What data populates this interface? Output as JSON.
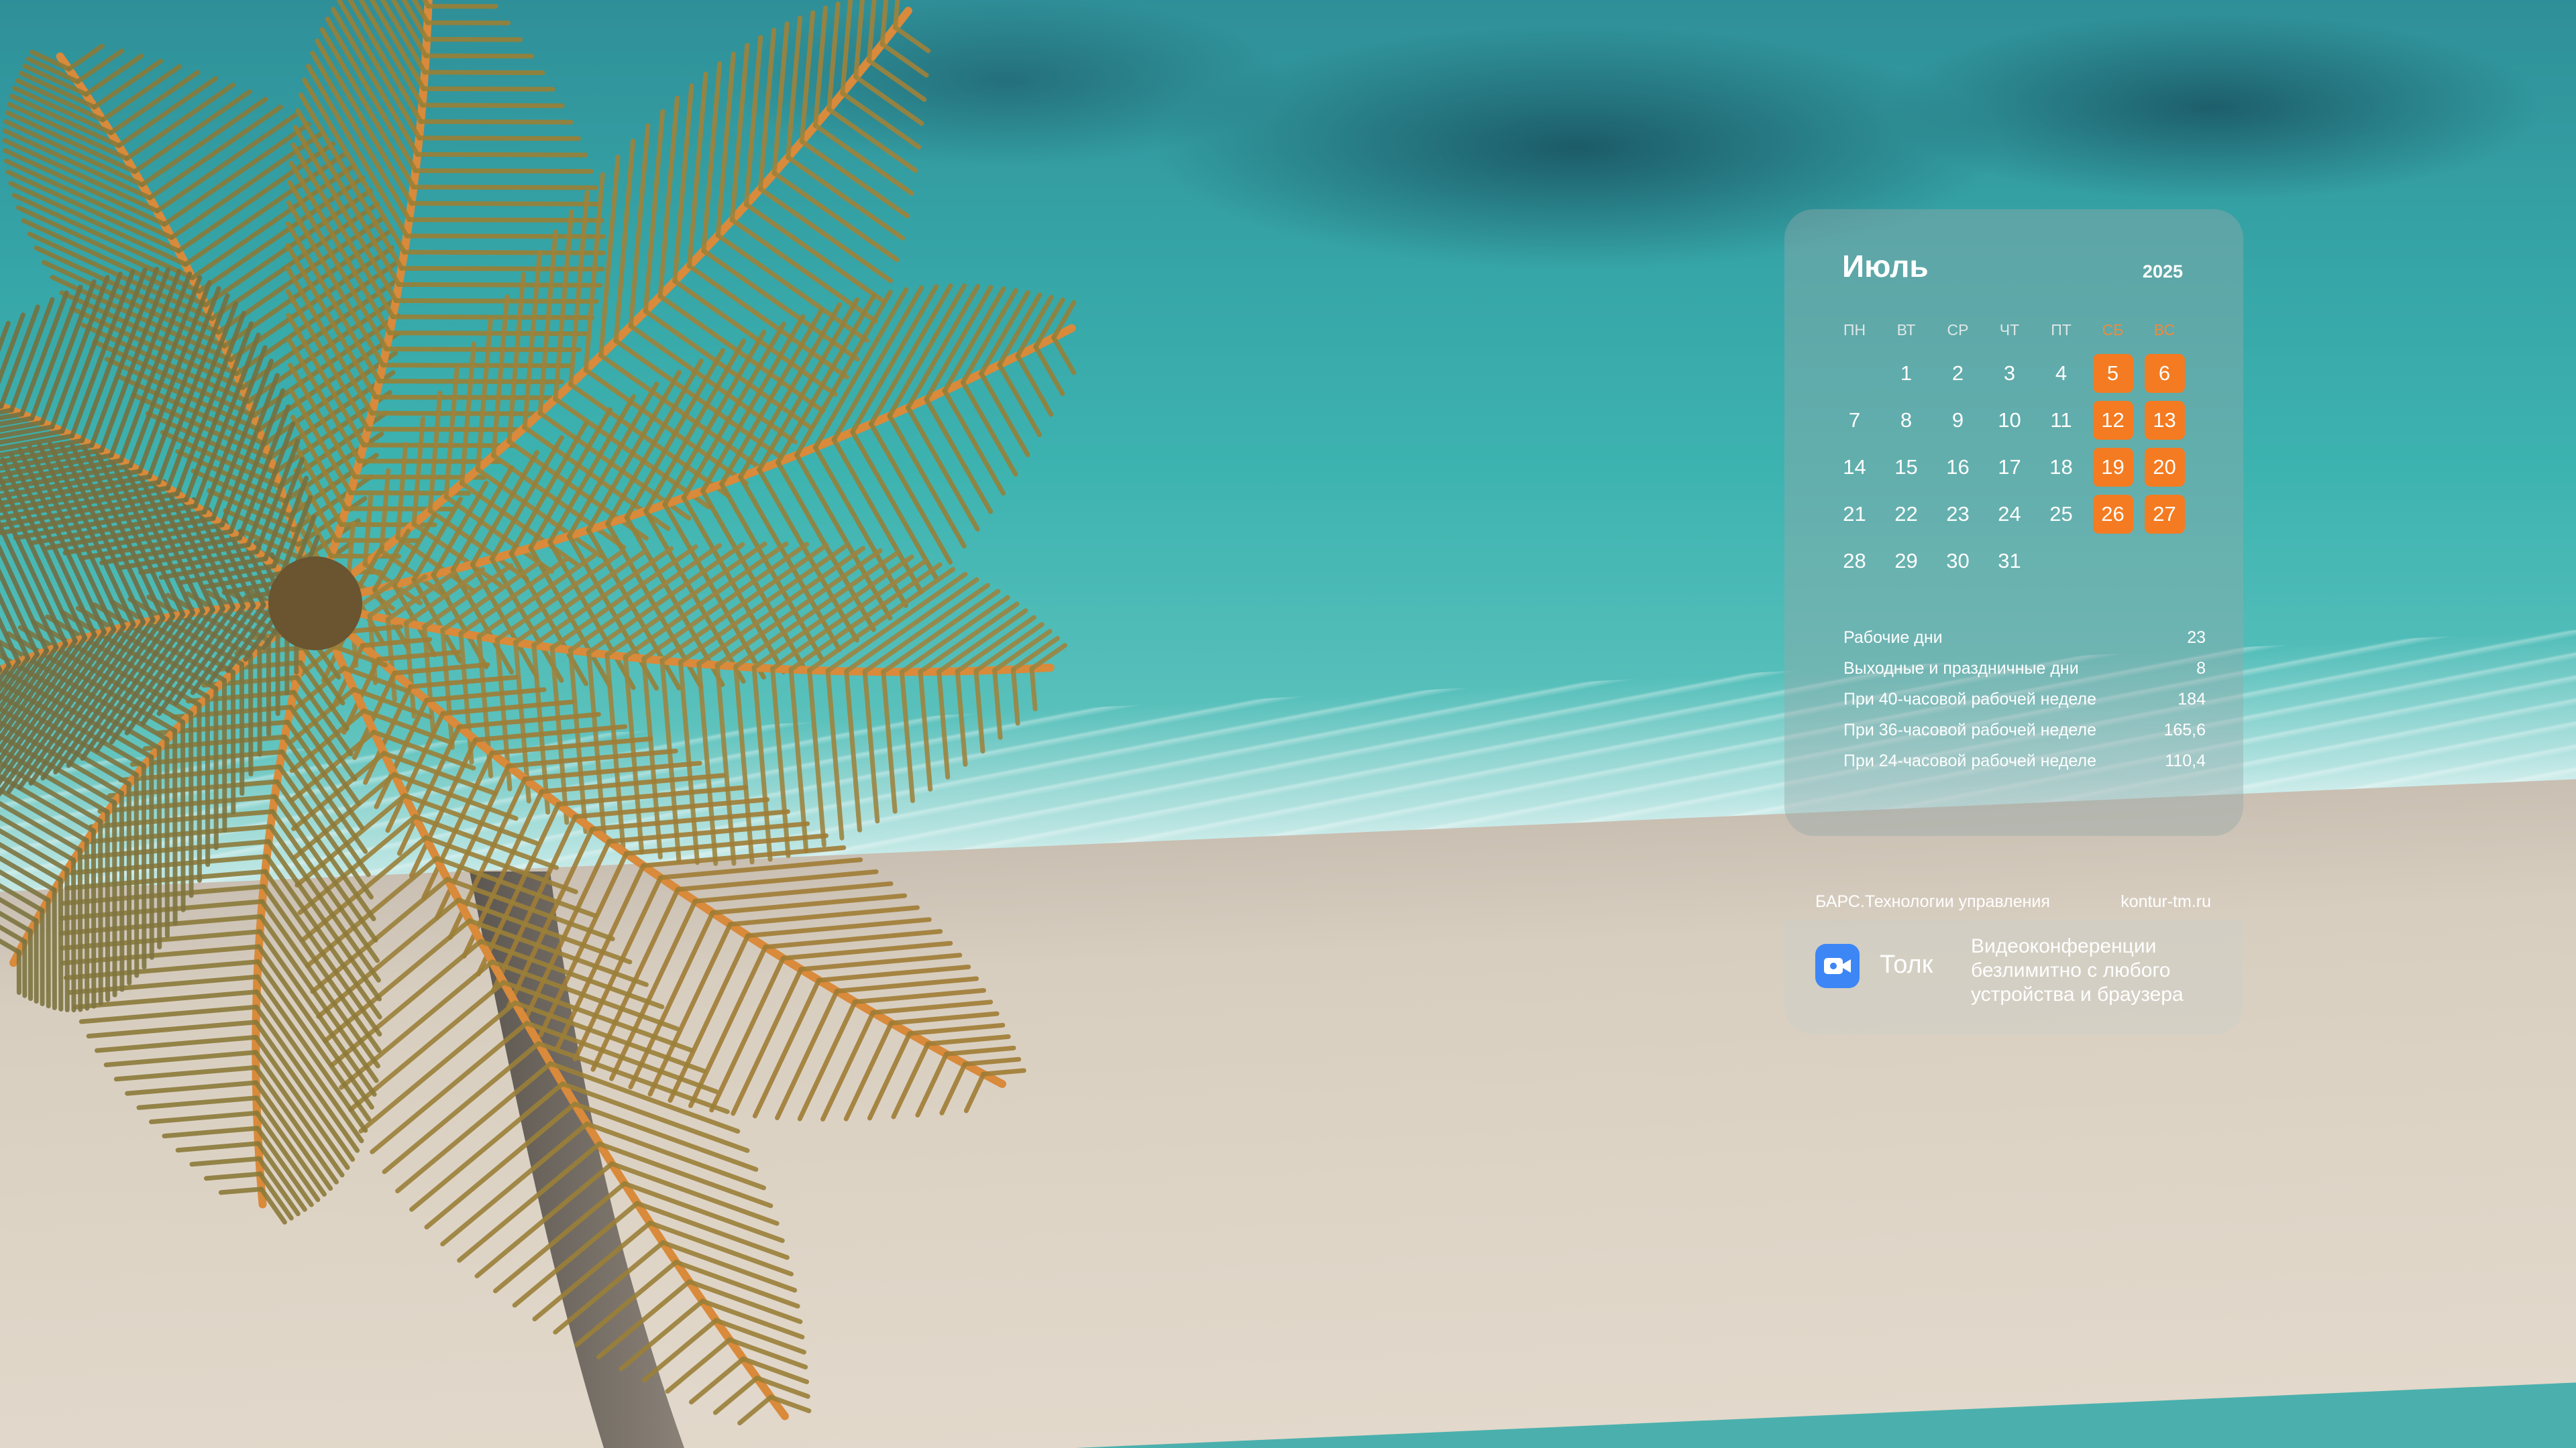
{
  "calendar": {
    "month": "Июль",
    "year": "2025",
    "weekdays": [
      "ПН",
      "ВТ",
      "СР",
      "ЧТ",
      "ПТ",
      "СБ",
      "ВС"
    ],
    "weeks": [
      [
        "",
        "1",
        "2",
        "3",
        "4",
        "5",
        "6"
      ],
      [
        "7",
        "8",
        "9",
        "10",
        "11",
        "12",
        "13"
      ],
      [
        "14",
        "15",
        "16",
        "17",
        "18",
        "19",
        "20"
      ],
      [
        "21",
        "22",
        "23",
        "24",
        "25",
        "26",
        "27"
      ],
      [
        "28",
        "29",
        "30",
        "31",
        "",
        "",
        ""
      ]
    ],
    "weekend_color": "#f47b21"
  },
  "stats": [
    {
      "label": "Рабочие дни",
      "value": "23"
    },
    {
      "label": "Выходные и праздничные дни",
      "value": "8"
    },
    {
      "label": "При 40-часовой рабочей неделе",
      "value": "184"
    },
    {
      "label": "При 36-часовой рабочей неделе",
      "value": "165,6"
    },
    {
      "label": "При 24-часовой рабочей неделе",
      "value": "110,4"
    }
  ],
  "brand": {
    "company": "БАРС.Технологии управления",
    "site": "kontur-tm.ru"
  },
  "ad": {
    "icon": "video-camera-icon",
    "name": "Толк",
    "description": "Видеоконференции безлимитно с любого устройства и браузера"
  }
}
